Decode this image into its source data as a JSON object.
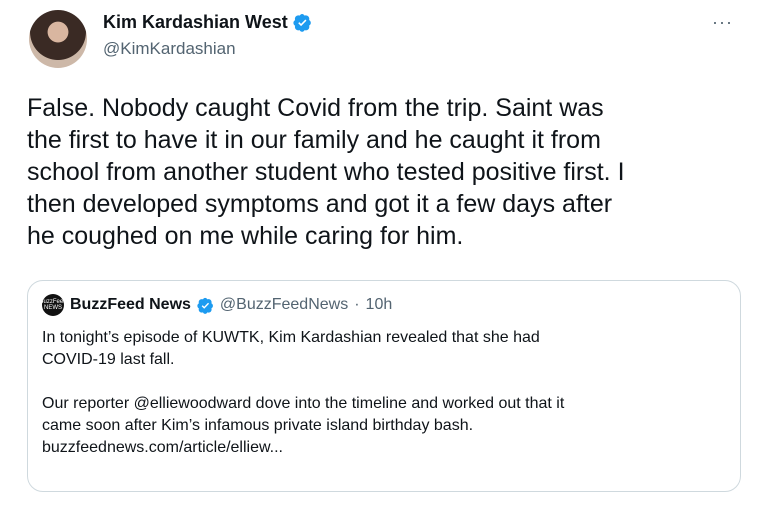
{
  "author": {
    "display_name": "Kim Kardashian West",
    "handle": "@KimKardashian",
    "verified": true
  },
  "more_menu": "···",
  "tweet": {
    "lines": [
      "False. Nobody caught Covid from the trip. Saint was",
      "the first to have it in our family and he caught it from",
      "school from another student who tested positive first. I",
      "then developed symptoms and got it a few days after",
      "he coughed on me while caring for him."
    ]
  },
  "quoted_tweet": {
    "avatar_text": "BuzzFeed NEWS",
    "display_name": "BuzzFeed News",
    "verified": true,
    "handle": "@BuzzFeedNews",
    "separator": "·",
    "time": "10h",
    "paragraph1": [
      "In tonight’s episode of KUWTK, Kim Kardashian revealed that she had",
      "COVID-19 last fall."
    ],
    "paragraph2": [
      "Our reporter @elliewoodward dove into the timeline and worked out that it",
      "came soon after Kim’s infamous private island birthday bash.",
      "buzzfeednews.com/article/elliew..."
    ]
  },
  "colors": {
    "verified_blue": "#1d9bf0",
    "text": "#0f1419",
    "secondary": "#536471",
    "border": "#cfd9de"
  }
}
